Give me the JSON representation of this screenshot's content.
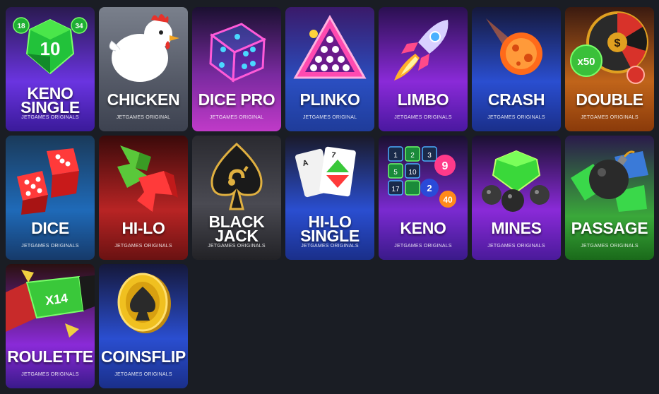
{
  "games": [
    {
      "id": "keno-single",
      "title": "KENO\nSINGLE",
      "subtitle": "JETGAMES ORIGINALS",
      "bg": [
        "#7a3cf0",
        "#3a1a9a"
      ],
      "numbers": [
        "18",
        "10",
        "34"
      ]
    },
    {
      "id": "chicken",
      "title": "CHICKEN",
      "subtitle": "JETGAMES ORIGINAL",
      "bg": [
        "#6b7180",
        "#3d4250"
      ]
    },
    {
      "id": "dice-pro",
      "title": "DICE PRO",
      "subtitle": "JETGAMES ORIGINAL",
      "bg": [
        "#c03ac8",
        "#5a1f8a"
      ]
    },
    {
      "id": "plinko",
      "title": "PLINKO",
      "subtitle": "JETGAMES ORIGINAL",
      "bg": [
        "#2a6ae0",
        "#1f3c9a"
      ]
    },
    {
      "id": "limbo",
      "title": "LIMBO",
      "subtitle": "JETGAMES ORIGINALS",
      "bg": [
        "#9a2ad8",
        "#4a18a0"
      ]
    },
    {
      "id": "crash",
      "title": "CRASH",
      "subtitle": "JETGAMES ORIGINALS",
      "bg": [
        "#2a5fd8",
        "#1a2f8a"
      ]
    },
    {
      "id": "double",
      "title": "DOUBLE",
      "subtitle": "JETGAMES ORIGINALS",
      "bg": [
        "#e07a1a",
        "#8a3a0a"
      ],
      "numbers": [
        "x50"
      ]
    },
    {
      "id": "dice",
      "title": "DICE",
      "subtitle": "JETGAMES ORIGINALS",
      "bg": [
        "#1f6ab8",
        "#163a6a"
      ]
    },
    {
      "id": "hi-lo",
      "title": "HI-LO",
      "subtitle": "JETGAMES ORIGINALS",
      "bg": [
        "#c02a2a",
        "#6a1212"
      ]
    },
    {
      "id": "blackjack",
      "title": "BLACK\nJACK",
      "subtitle": "JETGAMES ORIGINALS",
      "bg": [
        "#4a4a52",
        "#222226"
      ]
    },
    {
      "id": "hi-lo-single",
      "title": "HI-LO\nSINGLE",
      "subtitle": "JETGAMES ORIGINALS",
      "bg": [
        "#2a5fd8",
        "#1a2f8a"
      ],
      "numbers": [
        "A",
        "7"
      ]
    },
    {
      "id": "keno",
      "title": "KENO",
      "subtitle": "JETGAMES ORIGINALS",
      "bg": [
        "#8a2ad8",
        "#3a1a8a"
      ],
      "numbers": [
        "1",
        "2",
        "3",
        "5",
        "9",
        "10",
        "17",
        "2",
        "40"
      ]
    },
    {
      "id": "mines",
      "title": "MINES",
      "subtitle": "JETGAMES ORIGINALS",
      "bg": [
        "#9a2ad8",
        "#4a1a9a"
      ]
    },
    {
      "id": "passage",
      "title": "PASSAGE",
      "subtitle": "JETGAMES ORIGINALS",
      "bg": [
        "#3aa83a",
        "#1a6a1a"
      ]
    },
    {
      "id": "roulette",
      "title": "ROULETTE",
      "subtitle": "JETGAMES ORIGINALS",
      "bg": [
        "#8a2ad8",
        "#3a1a8a"
      ],
      "numbers": [
        "X14"
      ]
    },
    {
      "id": "coinsflip",
      "title": "COINSFLIP",
      "subtitle": "JETGAMES ORIGINALS",
      "bg": [
        "#2a5fd8",
        "#1a2f8a"
      ]
    }
  ]
}
